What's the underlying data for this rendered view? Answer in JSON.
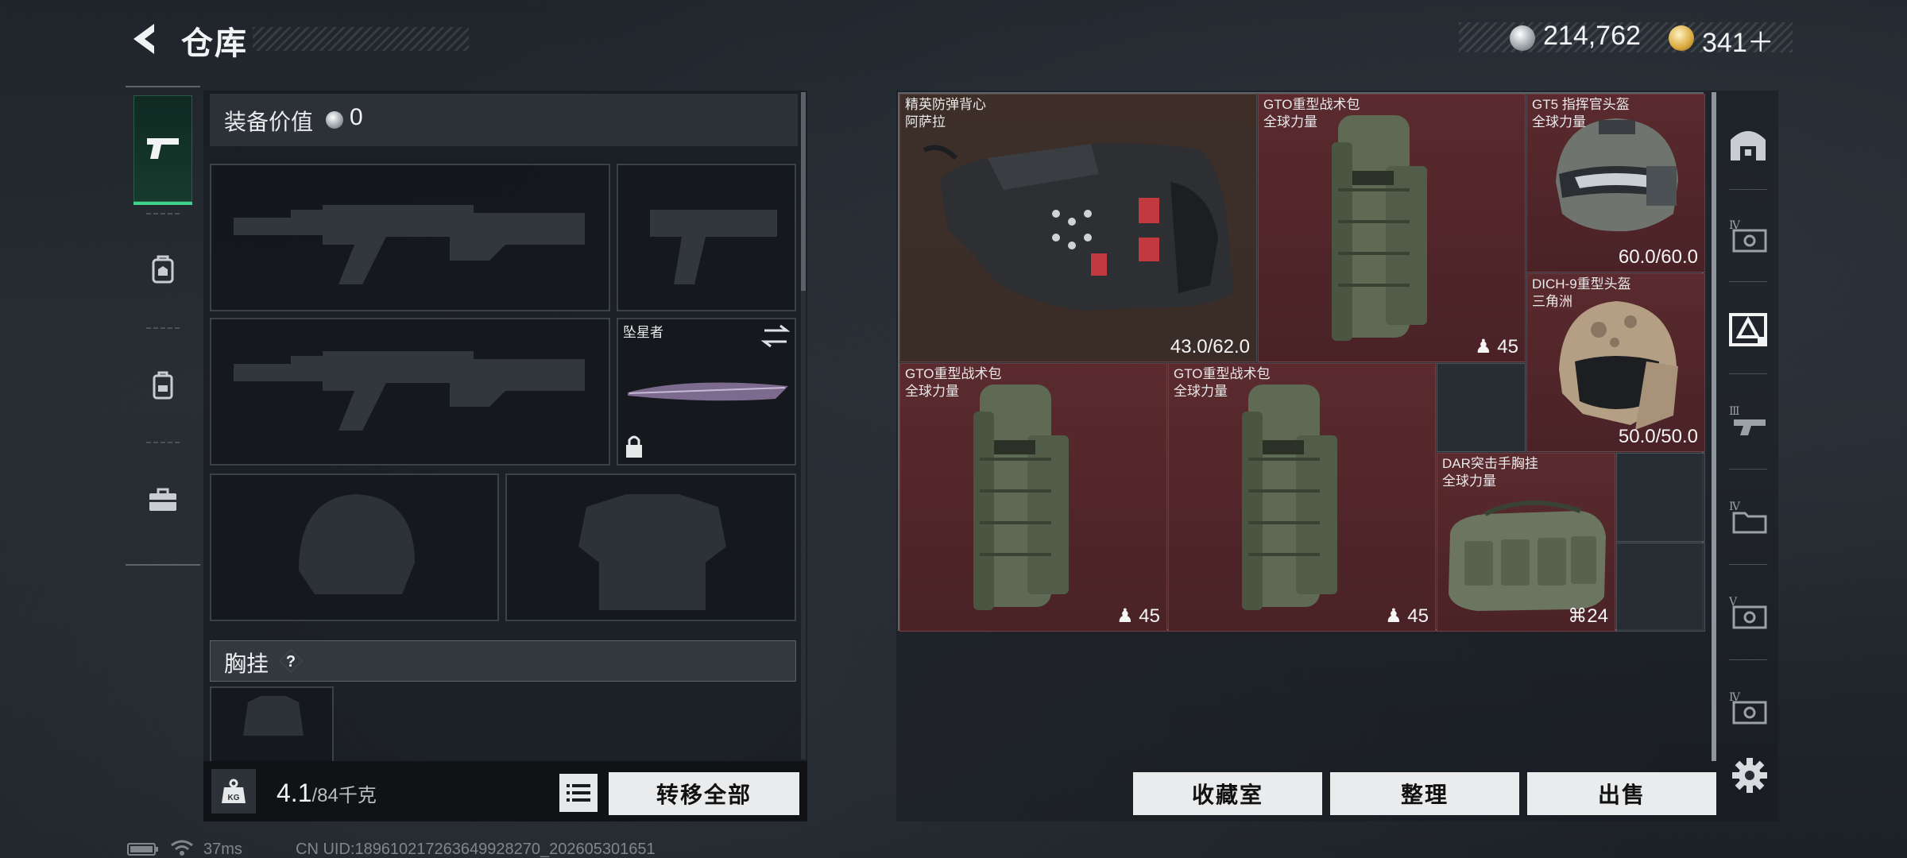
{
  "header": {
    "title": "仓库",
    "currency": [
      {
        "name": "silver-coin",
        "value": "214,762"
      },
      {
        "name": "gold-coin",
        "value": "341＋"
      }
    ]
  },
  "left": {
    "value_label": "装备价值",
    "value_num": "0",
    "melee_name": "坠星者",
    "chest_label": "胸挂",
    "help": "?",
    "weight_value": "4.1",
    "weight_max": "/84千克",
    "transfer_all": "转移全部"
  },
  "tabs": [
    "weapon-icon",
    "backpack-tag-icon",
    "backpack-icon",
    "toolbox-icon"
  ],
  "items": [
    {
      "name": "精英防弹背心",
      "sub": "阿萨拉",
      "stat": "43.0/62.0",
      "color": "#3d2f28"
    },
    {
      "name": "GTO重型战术包",
      "sub": "全球力量",
      "stat": "45",
      "color": "#5a2a2e"
    },
    {
      "name": "GT5 指挥官头盔",
      "sub": "全球力量",
      "stat": "60.0/60.0",
      "color": "#5a2a2e"
    },
    {
      "name": "DICH-9重型头盔",
      "sub": "三角洲",
      "stat": "50.0/50.0",
      "color": "#5a2a2e"
    },
    {
      "name": "GTO重型战术包",
      "sub": "全球力量",
      "stat": "45",
      "color": "#5a2a2e"
    },
    {
      "name": "GTO重型战术包",
      "sub": "全球力量",
      "stat": "45",
      "color": "#5a2a2e"
    },
    {
      "name": "DAR突击手胸挂",
      "sub": "全球力量",
      "stat": "24",
      "color": "#5a2a2e"
    }
  ],
  "side_labels": [
    "Ⅳ",
    "Ⅲ",
    "Ⅳ",
    "Ⅴ",
    "Ⅳ"
  ],
  "buttons": {
    "collection": "收藏室",
    "organize": "整理",
    "sell": "出售"
  },
  "status": {
    "ping": "37ms",
    "uid": "CN UID:18961021726364992​8270_202605301651"
  }
}
